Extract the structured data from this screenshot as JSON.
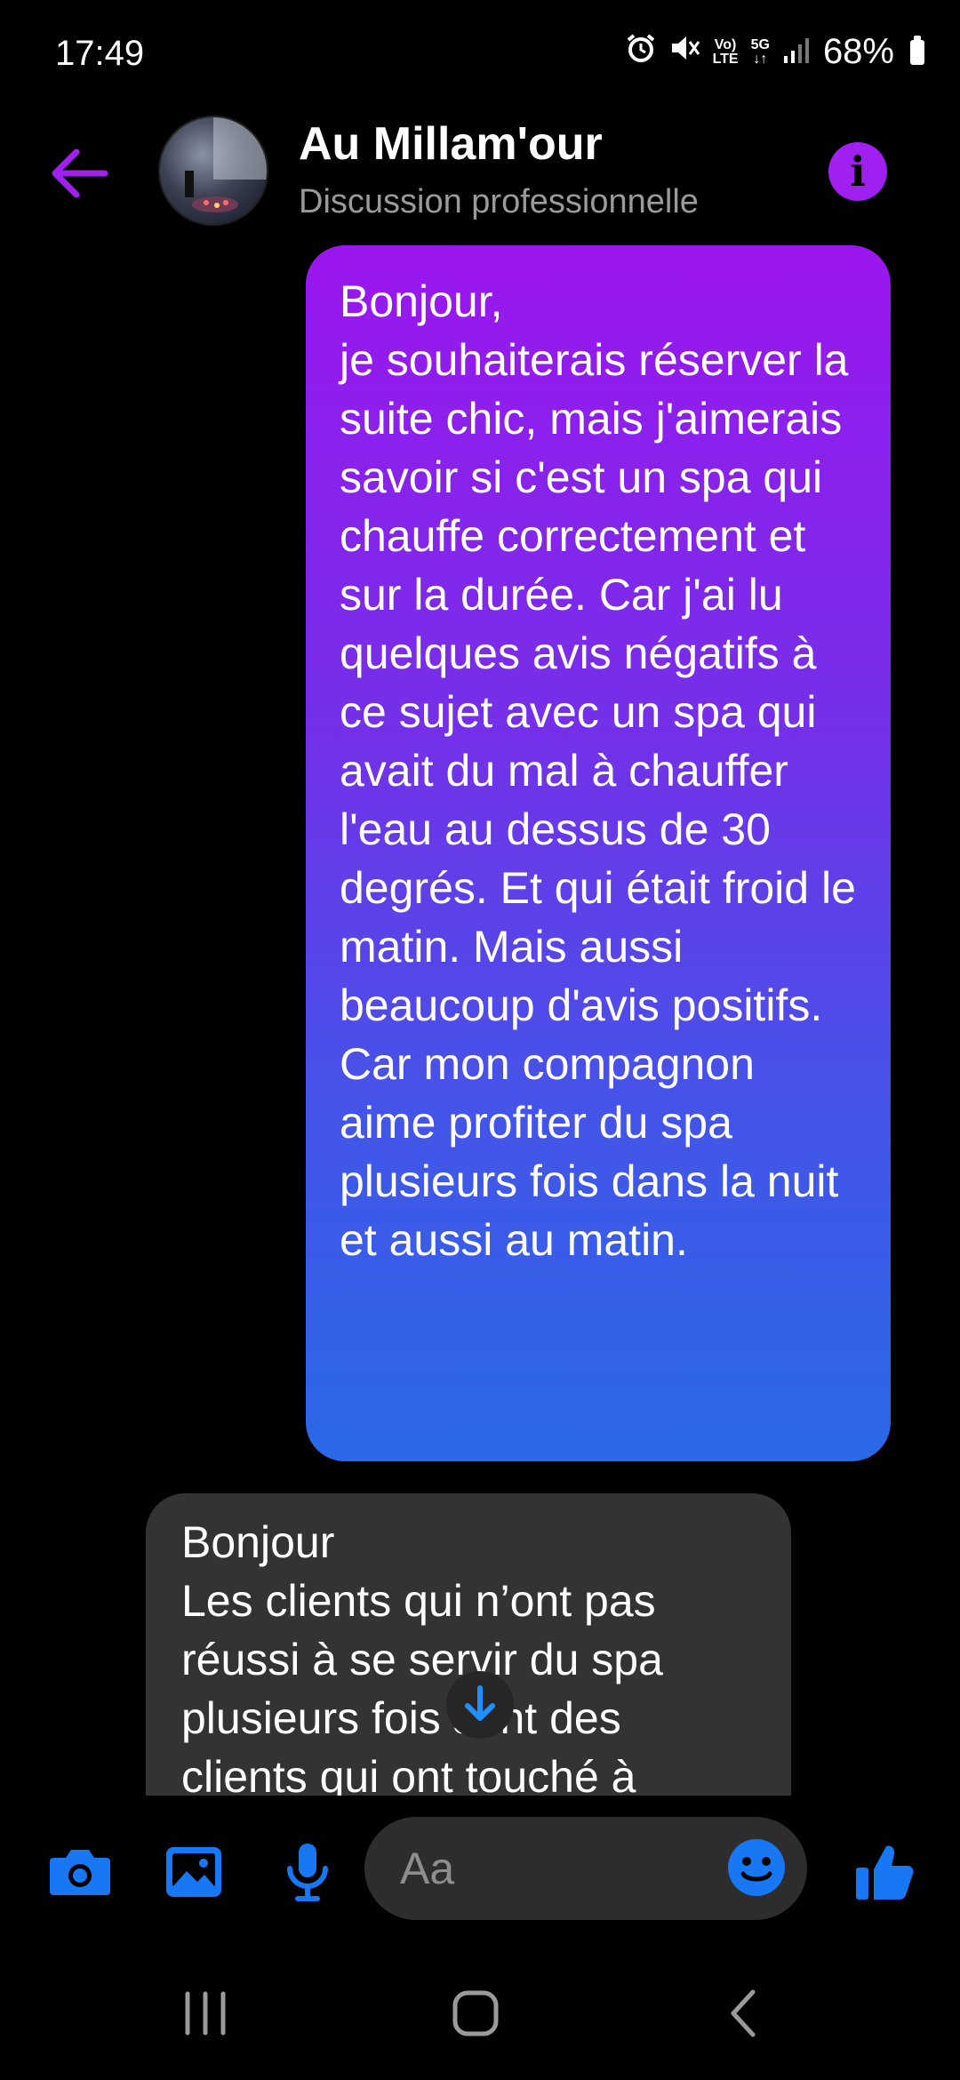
{
  "status_bar": {
    "time": "17:49",
    "battery": "68%",
    "network_label_top": "Vo)",
    "network_label_bottom": "LTE",
    "network_5g": "5G",
    "icons": [
      "alarm-icon",
      "mute-icon",
      "volte-icon",
      "5g-icon",
      "signal-icon",
      "battery-icon"
    ]
  },
  "header": {
    "title": "Au Millam'our",
    "subtitle": "Discussion professionnelle",
    "info_label": "i",
    "accent_color": "#a020f0"
  },
  "messages": [
    {
      "direction": "outgoing",
      "text": "Bonjour,\nje souhaiterais réserver la suite chic, mais j'aimerais savoir si c'est un spa qui chauffe correctement et sur la durée. Car j'ai lu quelques avis négatifs à ce sujet avec un spa qui avait du mal à chauffer l'eau au dessus de 30 degrés. Et qui était froid le matin. Mais aussi beaucoup d'avis positifs. Car mon compagnon aime profiter du spa plusieurs fois dans la nuit et aussi au matin."
    },
    {
      "direction": "incoming",
      "text": "Bonjour\nLes clients qui n’ont pas réussi à se servir du spa plusieurs fois sont des clients qui ont touché à"
    }
  ],
  "composer": {
    "placeholder": "Aa",
    "icon_color": "#1877f2",
    "icons": [
      "camera-icon",
      "gallery-icon",
      "microphone-icon",
      "emoji-icon",
      "thumbs-up-icon"
    ]
  },
  "navbar": {
    "icons": [
      "recent-apps-icon",
      "home-icon",
      "back-icon"
    ]
  }
}
